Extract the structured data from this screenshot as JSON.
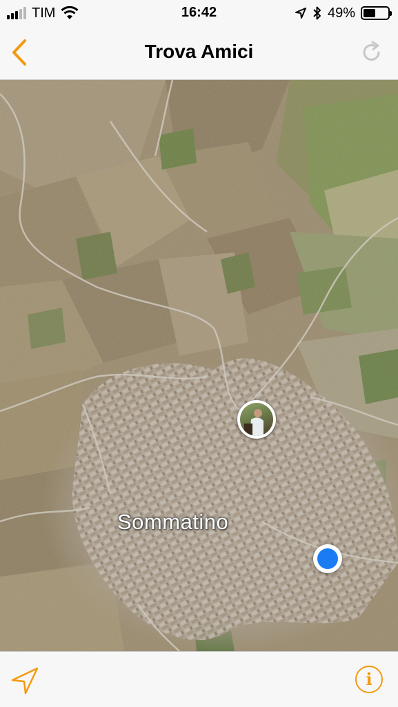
{
  "status_bar": {
    "carrier": "TIM",
    "time": "16:42",
    "battery_percent": "49%",
    "battery_level": 0.49,
    "signal_bars_filled": 3,
    "signal_bars_total": 5,
    "icons": [
      "signal-icon",
      "wifi-icon",
      "location-arrow-icon",
      "bluetooth-icon",
      "battery-icon"
    ]
  },
  "nav": {
    "title": "Trova Amici",
    "back_icon": "chevron-left-icon",
    "refresh_icon": "refresh-icon"
  },
  "map": {
    "type": "satellite",
    "place_label": "Sommatino",
    "friend_pin_icon": "friend-avatar",
    "user_location_icon": "current-location-dot"
  },
  "toolbar": {
    "locate_icon": "location-arrow-icon",
    "info_icon": "info-icon",
    "info_glyph": "i"
  },
  "colors": {
    "accent": "#f29a0e",
    "user_dot": "#1a7cf2",
    "bar_background": "#f7f7f7"
  }
}
